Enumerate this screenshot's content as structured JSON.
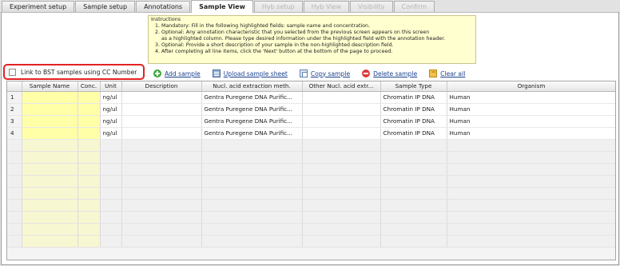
{
  "tabs": [
    {
      "label": "Experiment setup",
      "state": "normal"
    },
    {
      "label": "Sample setup",
      "state": "normal"
    },
    {
      "label": "Annotations",
      "state": "normal"
    },
    {
      "label": "Sample View",
      "state": "active"
    },
    {
      "label": "Hyb setup",
      "state": "disabled"
    },
    {
      "label": "Hyb View",
      "state": "disabled"
    },
    {
      "label": "Visibility",
      "state": "disabled"
    },
    {
      "label": "Confirm",
      "state": "disabled"
    }
  ],
  "instructions": {
    "title": "Instructions",
    "items": [
      {
        "line1": "1.  Mandatory: Fill in the following highlighted fields:  sample name and concentration.",
        "line2": ""
      },
      {
        "line1": "2.  Optional: Any annotation characteristic that you selected from the previous screen appears on this screen",
        "line2": "as a highlighted column. Please type desired information under the highlighted field with the annotation header."
      },
      {
        "line1": "3.  Optional: Provide a short description of your sample in the non-highlighted description field.",
        "line2": ""
      },
      {
        "line1": "4.  After completing all line items, click the 'Next' button at the bottom of the page to proceed.",
        "line2": ""
      }
    ]
  },
  "bst_link": {
    "label": "Link to BST samples using CC Number",
    "checked": false
  },
  "toolbar": {
    "add_sample": "Add sample",
    "upload_sheet": "Upload sample sheet",
    "copy_sample": "Copy sample",
    "delete_sample": "Delete sample",
    "clear_all": "Clear all"
  },
  "grid": {
    "columns": [
      "",
      "Sample Name",
      "Conc.",
      "Unit",
      "Description",
      "Nucl. acid extraction meth.",
      "Other Nucl. acid extr...",
      "Sample Type",
      "Organism"
    ],
    "rows": [
      {
        "num": "1",
        "sample_name": "",
        "conc": "",
        "unit": "ng/ul",
        "description": "",
        "extraction": "Gentra Puregene DNA Purific...",
        "other_extraction": "",
        "sample_type": "Chromatin IP DNA",
        "organism": "Human"
      },
      {
        "num": "2",
        "sample_name": "",
        "conc": "",
        "unit": "ng/ul",
        "description": "",
        "extraction": "Gentra Puregene DNA Purific...",
        "other_extraction": "",
        "sample_type": "Chromatin IP DNA",
        "organism": "Human"
      },
      {
        "num": "3",
        "sample_name": "",
        "conc": "",
        "unit": "ng/ul",
        "description": "",
        "extraction": "Gentra Puregene DNA Purific...",
        "other_extraction": "",
        "sample_type": "Chromatin IP DNA",
        "organism": "Human"
      },
      {
        "num": "4",
        "sample_name": "",
        "conc": "",
        "unit": "ng/ul",
        "description": "",
        "extraction": "Gentra Puregene DNA Purific...",
        "other_extraction": "",
        "sample_type": "Chromatin IP DNA",
        "organism": "Human"
      }
    ]
  },
  "colors": {
    "highlight_field": "#ffffa8",
    "instructions_bg": "#ffffcf",
    "callout_border": "#e22222",
    "link": "#1a3f8f"
  }
}
